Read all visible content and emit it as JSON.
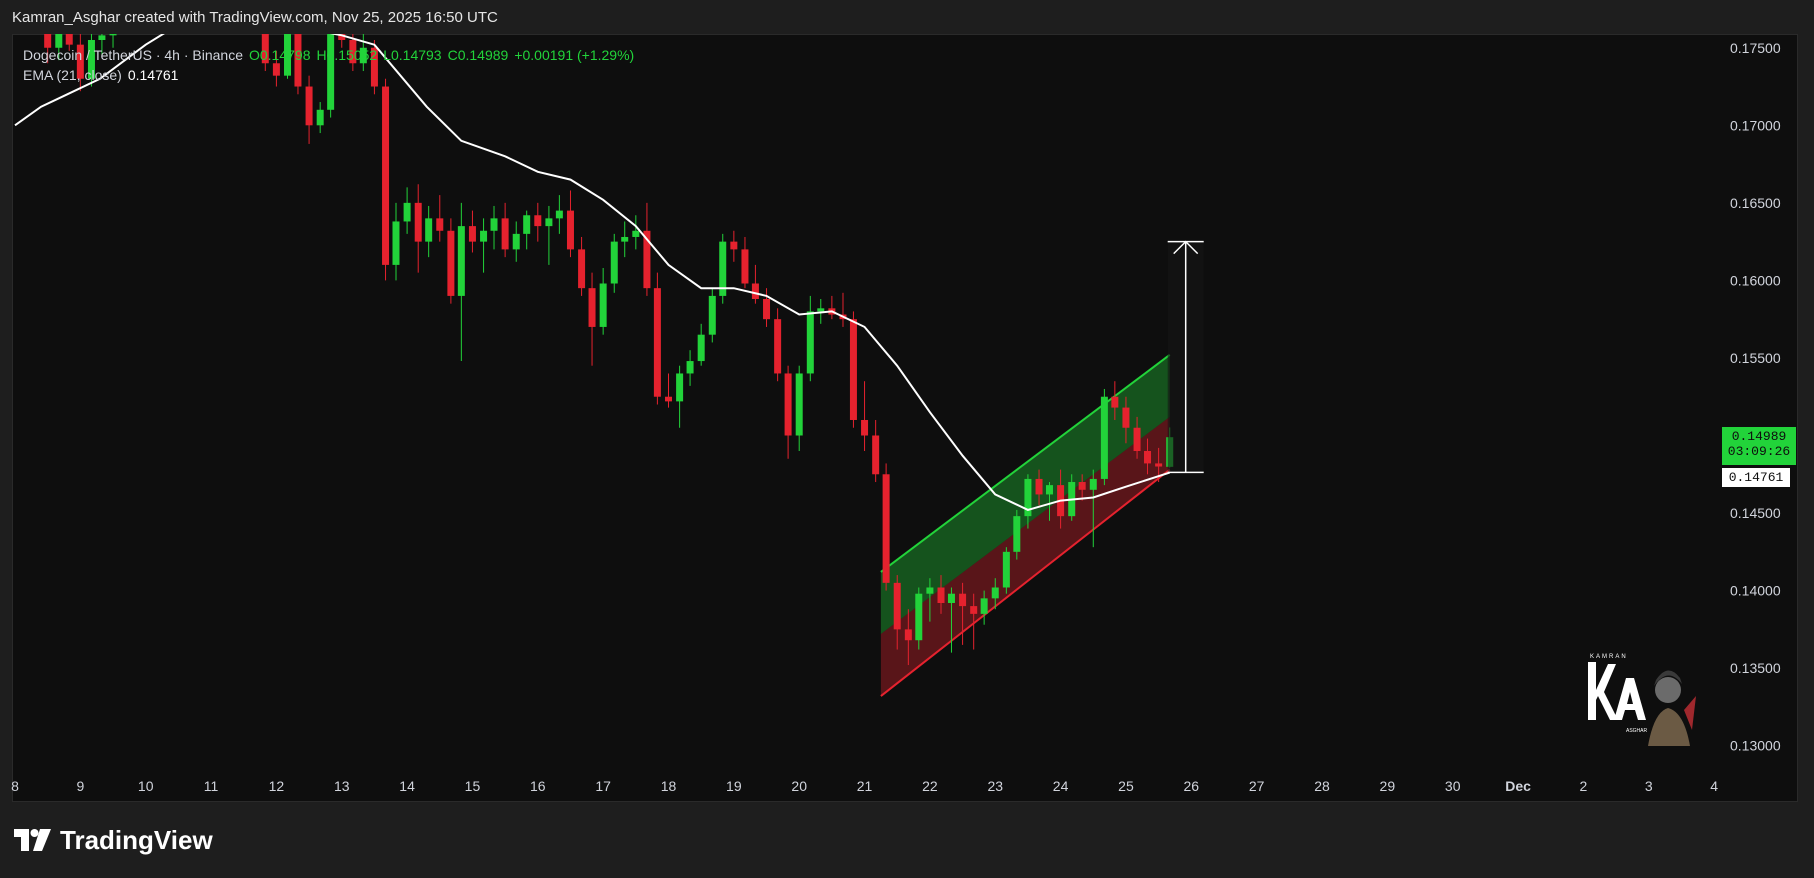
{
  "header": {
    "attribution": "Kamran_Asghar created with TradingView.com, Nov 25, 2025 16:50 UTC"
  },
  "legend": {
    "symbol": "Dogecoin / TetherUS · 4h · Binance",
    "open": "O0.14798",
    "high": "H0.15052",
    "low": "L0.14793",
    "close": "C0.14989",
    "change": "+0.00191 (+1.29%)",
    "ema_label": "EMA (21, close)",
    "ema_value": "0.14761"
  },
  "price_labels": {
    "last_price": "0.14989",
    "countdown": "03:09:26",
    "ema_price": "0.14761"
  },
  "branding": {
    "logo_text": "TradingView",
    "watermark_text": "KAMRAN ASGHAR"
  },
  "colors": {
    "up": "#22d33a",
    "down": "#e5222e",
    "ema": "#ffffff",
    "background": "#0e0e0e",
    "channel_upper": "#22d33a",
    "channel_lower": "#e5222e"
  },
  "chart_data": {
    "type": "candlestick",
    "title": "",
    "symbol": "Dogecoin / TetherUS",
    "interval": "4h",
    "exchange": "Binance",
    "y_axis": {
      "ticks": [
        "0.17500",
        "0.17000",
        "0.16500",
        "0.16000",
        "0.15500",
        "0.15000",
        "0.14500",
        "0.14000",
        "0.13500",
        "0.13000"
      ],
      "range": [
        0.1294,
        0.1755
      ]
    },
    "x_axis": {
      "ticks": [
        "8",
        "9",
        "10",
        "11",
        "12",
        "13",
        "14",
        "15",
        "16",
        "17",
        "18",
        "19",
        "20",
        "21",
        "22",
        "23",
        "24",
        "25",
        "26",
        "27",
        "28",
        "29",
        "30",
        "Dec",
        "2",
        "3",
        "4"
      ],
      "unit": "day (Nov–Dec 2025)",
      "range": [
        8,
        34.3
      ]
    },
    "candles": [
      [
        8.5,
        0.177,
        0.178,
        0.174,
        0.175
      ],
      [
        8.67,
        0.175,
        0.1765,
        0.1742,
        0.176
      ],
      [
        8.83,
        0.176,
        0.1778,
        0.1748,
        0.1752
      ],
      [
        9.0,
        0.1752,
        0.1765,
        0.1722,
        0.173
      ],
      [
        9.17,
        0.173,
        0.176,
        0.1725,
        0.1755
      ],
      [
        9.33,
        0.1755,
        0.176,
        0.1745,
        0.1758
      ],
      [
        9.5,
        0.1758,
        0.1775,
        0.175,
        0.1762
      ],
      [
        11.83,
        0.176,
        0.1765,
        0.1735,
        0.174
      ],
      [
        12.0,
        0.174,
        0.1748,
        0.1725,
        0.1732
      ],
      [
        12.17,
        0.1732,
        0.1765,
        0.173,
        0.176
      ],
      [
        12.33,
        0.176,
        0.1772,
        0.172,
        0.1725
      ],
      [
        12.5,
        0.1725,
        0.1732,
        0.1688,
        0.17
      ],
      [
        12.67,
        0.17,
        0.1715,
        0.1695,
        0.171
      ],
      [
        12.83,
        0.171,
        0.1772,
        0.1705,
        0.1765
      ],
      [
        13.0,
        0.1765,
        0.178,
        0.175,
        0.1755
      ],
      [
        13.17,
        0.1755,
        0.1768,
        0.1735,
        0.174
      ],
      [
        13.33,
        0.174,
        0.176,
        0.1735,
        0.175
      ],
      [
        13.5,
        0.175,
        0.1755,
        0.172,
        0.1725
      ],
      [
        13.67,
        0.1725,
        0.173,
        0.16,
        0.161
      ],
      [
        13.83,
        0.161,
        0.165,
        0.16,
        0.1638
      ],
      [
        14.0,
        0.1638,
        0.166,
        0.163,
        0.165
      ],
      [
        14.17,
        0.165,
        0.1662,
        0.1605,
        0.1625
      ],
      [
        14.33,
        0.1625,
        0.1648,
        0.1615,
        0.164
      ],
      [
        14.5,
        0.164,
        0.1655,
        0.1625,
        0.1632
      ],
      [
        14.67,
        0.1632,
        0.164,
        0.1585,
        0.159
      ],
      [
        14.83,
        0.159,
        0.165,
        0.1548,
        0.1635
      ],
      [
        15.0,
        0.1635,
        0.1645,
        0.1618,
        0.1625
      ],
      [
        15.17,
        0.1625,
        0.164,
        0.1605,
        0.1632
      ],
      [
        15.33,
        0.1632,
        0.1648,
        0.162,
        0.164
      ],
      [
        15.5,
        0.164,
        0.165,
        0.1615,
        0.162
      ],
      [
        15.67,
        0.162,
        0.1638,
        0.1612,
        0.163
      ],
      [
        15.83,
        0.163,
        0.1645,
        0.162,
        0.1642
      ],
      [
        16.0,
        0.1642,
        0.165,
        0.1625,
        0.1635
      ],
      [
        16.17,
        0.1635,
        0.1648,
        0.161,
        0.164
      ],
      [
        16.33,
        0.164,
        0.1655,
        0.163,
        0.1645
      ],
      [
        16.5,
        0.1645,
        0.1658,
        0.1615,
        0.162
      ],
      [
        16.67,
        0.162,
        0.1628,
        0.159,
        0.1595
      ],
      [
        16.83,
        0.1595,
        0.1605,
        0.1545,
        0.157
      ],
      [
        17.0,
        0.157,
        0.1608,
        0.1565,
        0.1598
      ],
      [
        17.17,
        0.1598,
        0.163,
        0.1592,
        0.1625
      ],
      [
        17.33,
        0.1625,
        0.1638,
        0.1615,
        0.1628
      ],
      [
        17.5,
        0.1628,
        0.1642,
        0.162,
        0.1632
      ],
      [
        17.67,
        0.1632,
        0.165,
        0.159,
        0.1595
      ],
      [
        17.83,
        0.1595,
        0.1605,
        0.152,
        0.1525
      ],
      [
        18.0,
        0.1525,
        0.154,
        0.1518,
        0.1522
      ],
      [
        18.17,
        0.1522,
        0.1545,
        0.1505,
        0.154
      ],
      [
        18.33,
        0.154,
        0.1555,
        0.1532,
        0.1548
      ],
      [
        18.5,
        0.1548,
        0.1572,
        0.1545,
        0.1565
      ],
      [
        18.67,
        0.1565,
        0.1595,
        0.156,
        0.159
      ],
      [
        18.83,
        0.159,
        0.163,
        0.1585,
        0.1625
      ],
      [
        19.0,
        0.1625,
        0.1632,
        0.1612,
        0.162
      ],
      [
        19.17,
        0.162,
        0.1628,
        0.1595,
        0.1598
      ],
      [
        19.33,
        0.1598,
        0.161,
        0.1585,
        0.1588
      ],
      [
        19.5,
        0.1588,
        0.1595,
        0.157,
        0.1575
      ],
      [
        19.67,
        0.1575,
        0.1582,
        0.1535,
        0.154
      ],
      [
        19.83,
        0.154,
        0.1545,
        0.1485,
        0.15
      ],
      [
        20.0,
        0.15,
        0.1545,
        0.149,
        0.154
      ],
      [
        20.17,
        0.154,
        0.159,
        0.1535,
        0.158
      ],
      [
        20.33,
        0.158,
        0.1588,
        0.1572,
        0.1582
      ],
      [
        20.5,
        0.1582,
        0.159,
        0.1575,
        0.1578
      ],
      [
        20.67,
        0.1578,
        0.1592,
        0.157,
        0.1575
      ],
      [
        20.83,
        0.1575,
        0.158,
        0.1505,
        0.151
      ],
      [
        21.0,
        0.151,
        0.1535,
        0.149,
        0.15
      ],
      [
        21.17,
        0.15,
        0.151,
        0.147,
        0.1475
      ],
      [
        21.33,
        0.1475,
        0.1482,
        0.14,
        0.1405
      ],
      [
        21.5,
        0.1405,
        0.141,
        0.1362,
        0.1375
      ],
      [
        21.67,
        0.1375,
        0.1388,
        0.1352,
        0.1368
      ],
      [
        21.83,
        0.1368,
        0.1402,
        0.1362,
        0.1398
      ],
      [
        22.0,
        0.1398,
        0.1408,
        0.138,
        0.1402
      ],
      [
        22.17,
        0.1402,
        0.141,
        0.1385,
        0.1392
      ],
      [
        22.33,
        0.1392,
        0.1402,
        0.136,
        0.1398
      ],
      [
        22.5,
        0.1398,
        0.1405,
        0.1365,
        0.139
      ],
      [
        22.67,
        0.139,
        0.1398,
        0.1362,
        0.1385
      ],
      [
        22.83,
        0.1385,
        0.14,
        0.1378,
        0.1395
      ],
      [
        23.0,
        0.1395,
        0.1408,
        0.1388,
        0.1402
      ],
      [
        23.17,
        0.1402,
        0.1428,
        0.1398,
        0.1425
      ],
      [
        23.33,
        0.1425,
        0.1452,
        0.142,
        0.1448
      ],
      [
        23.5,
        0.1448,
        0.1475,
        0.144,
        0.1472
      ],
      [
        23.67,
        0.1472,
        0.1478,
        0.1455,
        0.1462
      ],
      [
        23.83,
        0.1462,
        0.147,
        0.1445,
        0.1468
      ],
      [
        24.0,
        0.1468,
        0.1478,
        0.144,
        0.1448
      ],
      [
        24.17,
        0.1448,
        0.1475,
        0.1445,
        0.147
      ],
      [
        24.33,
        0.147,
        0.1475,
        0.1458,
        0.1465
      ],
      [
        24.5,
        0.1465,
        0.1478,
        0.1428,
        0.1472
      ],
      [
        24.67,
        0.1472,
        0.153,
        0.1468,
        0.1525
      ],
      [
        24.83,
        0.1525,
        0.1535,
        0.151,
        0.1518
      ],
      [
        25.0,
        0.1518,
        0.1525,
        0.1495,
        0.1505
      ],
      [
        25.17,
        0.1505,
        0.1512,
        0.1485,
        0.149
      ],
      [
        25.33,
        0.149,
        0.1498,
        0.1475,
        0.1482
      ],
      [
        25.5,
        0.1482,
        0.1492,
        0.147,
        0.148
      ],
      [
        25.67,
        0.14798,
        0.15052,
        0.14793,
        0.14989
      ]
    ],
    "ema": {
      "name": "EMA (21, close)",
      "points": [
        [
          8.0,
          0.17
        ],
        [
          8.4,
          0.1712
        ],
        [
          8.8,
          0.172
        ],
        [
          9.3,
          0.173
        ],
        [
          10.0,
          0.1752
        ],
        [
          10.5,
          0.1765
        ],
        [
          11.0,
          0.178
        ],
        [
          12.5,
          0.1762
        ],
        [
          13.0,
          0.1758
        ],
        [
          13.5,
          0.1752
        ],
        [
          14.3,
          0.1712
        ],
        [
          14.83,
          0.169
        ],
        [
          15.5,
          0.168
        ],
        [
          16.0,
          0.167
        ],
        [
          16.5,
          0.1665
        ],
        [
          17.0,
          0.1652
        ],
        [
          17.5,
          0.1635
        ],
        [
          18.0,
          0.161
        ],
        [
          18.5,
          0.1595
        ],
        [
          19.0,
          0.1595
        ],
        [
          19.5,
          0.159
        ],
        [
          20.0,
          0.1578
        ],
        [
          20.5,
          0.158
        ],
        [
          21.0,
          0.157
        ],
        [
          21.5,
          0.1545
        ],
        [
          22.0,
          0.1515
        ],
        [
          22.5,
          0.1487
        ],
        [
          23.0,
          0.1462
        ],
        [
          23.5,
          0.1452
        ],
        [
          24.0,
          0.1458
        ],
        [
          24.5,
          0.146
        ],
        [
          25.0,
          0.1467
        ],
        [
          25.67,
          0.14761
        ]
      ]
    },
    "channel": {
      "upper": [
        [
          21.25,
          0.1412
        ],
        [
          25.67,
          0.1552
        ]
      ],
      "middle": [
        [
          21.25,
          0.1372
        ],
        [
          25.67,
          0.1512
        ]
      ],
      "lower": [
        [
          21.25,
          0.1332
        ],
        [
          25.67,
          0.1478
        ]
      ]
    },
    "projection": {
      "x": 25.7,
      "from": 0.14762,
      "to": 0.1625
    },
    "grid": false,
    "legend_position": "top-left"
  }
}
